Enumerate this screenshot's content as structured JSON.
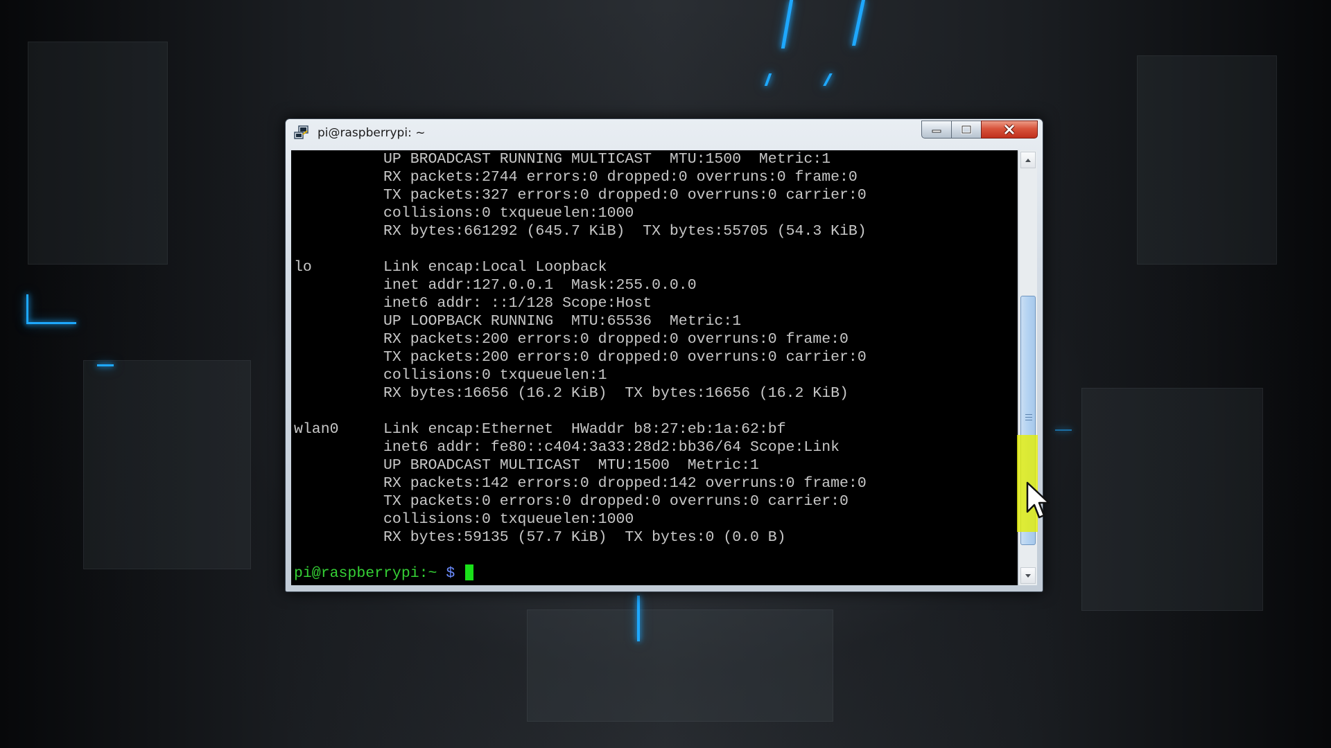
{
  "window": {
    "title": "pi@raspberrypi: ~",
    "title_icon": "putty-icon",
    "controls": {
      "minimize_icon": "minimize-icon",
      "maximize_icon": "maximize-icon",
      "close_icon": "close-icon"
    }
  },
  "terminal": {
    "lines": [
      "          UP BROADCAST RUNNING MULTICAST  MTU:1500  Metric:1",
      "          RX packets:2744 errors:0 dropped:0 overruns:0 frame:0",
      "          TX packets:327 errors:0 dropped:0 overruns:0 carrier:0",
      "          collisions:0 txqueuelen:1000",
      "          RX bytes:661292 (645.7 KiB)  TX bytes:55705 (54.3 KiB)",
      "",
      "lo        Link encap:Local Loopback",
      "          inet addr:127.0.0.1  Mask:255.0.0.0",
      "          inet6 addr: ::1/128 Scope:Host",
      "          UP LOOPBACK RUNNING  MTU:65536  Metric:1",
      "          RX packets:200 errors:0 dropped:0 overruns:0 frame:0",
      "          TX packets:200 errors:0 dropped:0 overruns:0 carrier:0",
      "          collisions:0 txqueuelen:1",
      "          RX bytes:16656 (16.2 KiB)  TX bytes:16656 (16.2 KiB)",
      "",
      "wlan0     Link encap:Ethernet  HWaddr b8:27:eb:1a:62:bf",
      "          inet6 addr: fe80::c404:3a33:28d2:bb36/64 Scope:Link",
      "          UP BROADCAST MULTICAST  MTU:1500  Metric:1",
      "          RX packets:142 errors:0 dropped:142 overruns:0 frame:0",
      "          TX packets:0 errors:0 dropped:0 overruns:0 carrier:0",
      "          collisions:0 txqueuelen:1000",
      "          RX bytes:59135 (57.7 KiB)  TX bytes:0 (0.0 B)",
      ""
    ],
    "prompt_user": "pi@raspberrypi:~",
    "prompt_symbol": " $ ",
    "colors": {
      "background": "#000000",
      "text": "#c8c8c8",
      "prompt_user": "#35d035",
      "prompt_symbol": "#6c8cff",
      "cursor": "#19e019"
    }
  },
  "scrollbar": {
    "up_icon": "scroll-up-arrow-icon",
    "down_icon": "scroll-down-arrow-icon",
    "position_fraction": 0.85
  },
  "overlay": {
    "highlight_color": "#e6f000",
    "pointer_icon": "mouse-pointer-icon"
  }
}
